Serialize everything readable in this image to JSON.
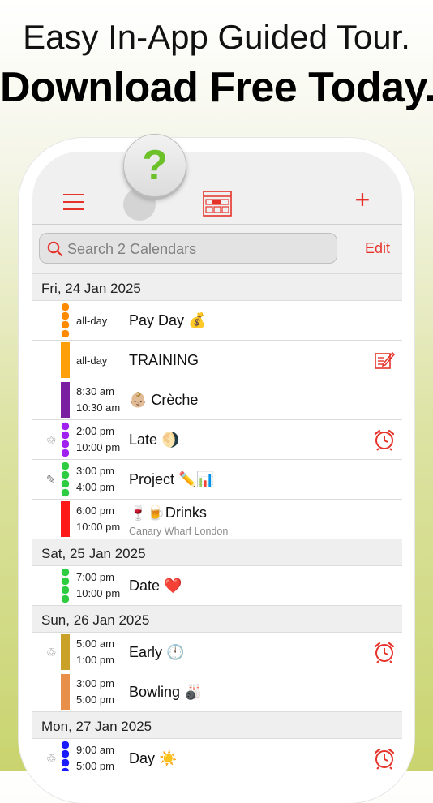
{
  "headline": {
    "line1": "Easy In-App Guided Tour.",
    "line2": "Download Free Today."
  },
  "help": {
    "symbol": "?"
  },
  "nav": {
    "menu_icon": "hamburger-icon",
    "calendar_icon": "calendar-view-icon",
    "add_label": "+"
  },
  "search": {
    "placeholder": "Search 2 Calendars",
    "edit_label": "Edit"
  },
  "sections": [
    {
      "date": "Fri, 24 Jan 2025",
      "events": [
        {
          "time1": "all-day",
          "time2": "",
          "title": "Pay Day 💰",
          "subtitle": "",
          "color": "#ff8a00",
          "pattern": "dots",
          "left_icon": "",
          "right_icon": ""
        },
        {
          "time1": "all-day",
          "time2": "",
          "title": "TRAINING",
          "subtitle": "",
          "color": "#ff9f0a",
          "pattern": "solid",
          "left_icon": "",
          "right_icon": "edit-note-icon"
        },
        {
          "time1": "8:30 am",
          "time2": "10:30 am",
          "title": "👶🏼 Crèche",
          "subtitle": "",
          "color": "#7b1fa2",
          "pattern": "solid",
          "left_icon": "",
          "right_icon": ""
        },
        {
          "time1": "2:00 pm",
          "time2": "10:00 pm",
          "title": "Late 🌖",
          "subtitle": "",
          "color": "#a020f0",
          "pattern": "dots",
          "left_icon": "♲",
          "right_icon": "alarm-icon"
        },
        {
          "time1": "3:00 pm",
          "time2": "4:00 pm",
          "title": "Project ✏️📊",
          "subtitle": "",
          "color": "#2ecc40",
          "pattern": "dots",
          "left_icon": "✎",
          "right_icon": ""
        },
        {
          "time1": "6:00 pm",
          "time2": "10:00 pm",
          "title": "🍷🍺Drinks",
          "subtitle": "Canary Wharf London",
          "color": "#ff1a1a",
          "pattern": "solid",
          "left_icon": "",
          "right_icon": ""
        }
      ]
    },
    {
      "date": "Sat, 25 Jan 2025",
      "events": [
        {
          "time1": "7:00 pm",
          "time2": "10:00 pm",
          "title": "Date ❤️",
          "subtitle": "",
          "color": "#2ecc40",
          "pattern": "dots",
          "left_icon": "",
          "right_icon": ""
        }
      ]
    },
    {
      "date": "Sun, 26 Jan 2025",
      "events": [
        {
          "time1": "5:00 am",
          "time2": "1:00 pm",
          "title": "Early 🕚",
          "subtitle": "",
          "color": "#c9a227",
          "pattern": "solid",
          "left_icon": "♲",
          "right_icon": "alarm-icon"
        },
        {
          "time1": "3:00 pm",
          "time2": "5:00 pm",
          "title": "Bowling 🎳",
          "subtitle": "",
          "color": "#e8904a",
          "pattern": "solid",
          "left_icon": "",
          "right_icon": ""
        }
      ]
    },
    {
      "date": "Mon, 27 Jan 2025",
      "events": [
        {
          "time1": "9:00 am",
          "time2": "5:00 pm",
          "title": "Day ☀️",
          "subtitle": "",
          "color": "#1a1aff",
          "pattern": "dots",
          "left_icon": "♲",
          "right_icon": "alarm-icon"
        }
      ]
    }
  ]
}
